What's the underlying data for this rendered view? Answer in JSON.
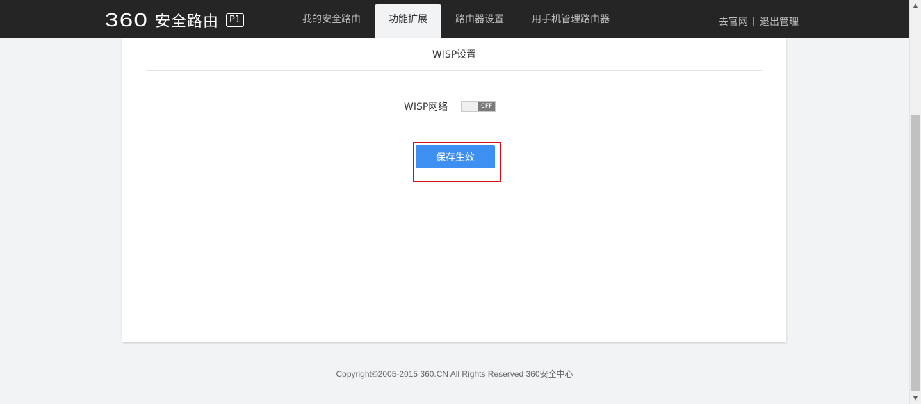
{
  "header": {
    "logo_number": "360",
    "logo_text": "安全路由",
    "logo_badge": "P1",
    "nav_tabs": [
      {
        "label": "我的安全路由",
        "active": false
      },
      {
        "label": "功能扩展",
        "active": true
      },
      {
        "label": "路由器设置",
        "active": false
      },
      {
        "label": "用手机管理路由器",
        "active": false
      }
    ],
    "links": {
      "official_site": "去官网",
      "logout": "退出管理"
    }
  },
  "panel": {
    "title": "WISP设置",
    "wisp_label": "WISP网络",
    "wisp_toggle": {
      "state": "OFF",
      "enabled": false
    },
    "save_label": "保存生效"
  },
  "footer": {
    "copyright": "Copyright©2005-2015 360.CN All Rights Reserved 360安全中心"
  },
  "colors": {
    "header_bg": "#252525",
    "page_bg": "#f2f3f5",
    "primary_button": "#3d8ff2",
    "highlight_border": "#d0131a"
  }
}
